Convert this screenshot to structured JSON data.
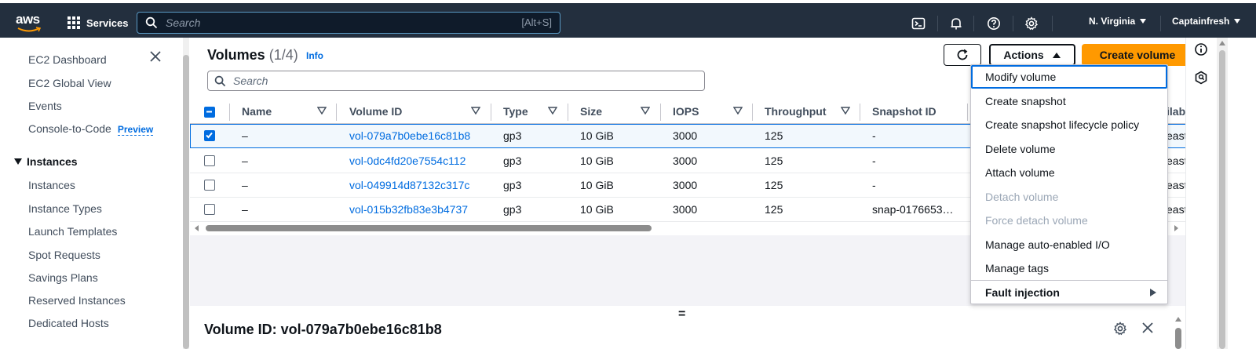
{
  "topbar": {
    "logo": "aws",
    "services_label": "Services",
    "search_placeholder": "Search",
    "search_shortcut": "[Alt+S]",
    "region": "N. Virginia",
    "account": "Captainfresh",
    "icons": [
      "cloudshell-icon",
      "notifications-icon",
      "help-icon",
      "settings-icon"
    ],
    "bg_color": "#232f3e"
  },
  "sidebar": {
    "items_top": [
      "EC2 Dashboard",
      "EC2 Global View",
      "Events",
      "Console-to-Code"
    ],
    "preview_tag": "Preview",
    "section": "Instances",
    "section_items": [
      "Instances",
      "Instance Types",
      "Launch Templates",
      "Spot Requests",
      "Savings Plans",
      "Reserved Instances",
      "Dedicated Hosts"
    ]
  },
  "main": {
    "title": "Volumes",
    "count": "(1/4)",
    "info": "Info",
    "actions_label": "Actions",
    "create_label": "Create volume",
    "search_placeholder": "Search",
    "columns": [
      "Name",
      "Volume ID",
      "Type",
      "Size",
      "IOPS",
      "Throughput",
      "Snapshot ID",
      "ilab"
    ],
    "rows": [
      {
        "selected": true,
        "name": "–",
        "volume_id": "vol-079a7b0ebe16c81b8",
        "type": "gp3",
        "size": "10 GiB",
        "iops": "3000",
        "throughput": "125",
        "snapshot": "-",
        "az": "east"
      },
      {
        "selected": false,
        "name": "–",
        "volume_id": "vol-0dc4fd20e7554c112",
        "type": "gp3",
        "size": "10 GiB",
        "iops": "3000",
        "throughput": "125",
        "snapshot": "-",
        "az": "east"
      },
      {
        "selected": false,
        "name": "–",
        "volume_id": "vol-049914d87132c317c",
        "type": "gp3",
        "size": "10 GiB",
        "iops": "3000",
        "throughput": "125",
        "snapshot": "-",
        "az": "east"
      },
      {
        "selected": false,
        "name": "–",
        "volume_id": "vol-015b32fb83e3b4737",
        "type": "gp3",
        "size": "10 GiB",
        "iops": "3000",
        "throughput": "125",
        "snapshot": "snap-0176653…",
        "az": "east"
      }
    ],
    "detail_title": "Volume ID: vol-079a7b0ebe16c81b8",
    "resizer": "="
  },
  "actions_menu": {
    "items": [
      {
        "label": "Modify volume",
        "state": "focused"
      },
      {
        "label": "Create snapshot",
        "state": "enabled"
      },
      {
        "label": "Create snapshot lifecycle policy",
        "state": "enabled"
      },
      {
        "label": "Delete volume",
        "state": "enabled"
      },
      {
        "label": "Attach volume",
        "state": "enabled"
      },
      {
        "label": "Detach volume",
        "state": "disabled"
      },
      {
        "label": "Force detach volume",
        "state": "disabled"
      },
      {
        "label": "Manage auto-enabled I/O",
        "state": "enabled"
      },
      {
        "label": "Manage tags",
        "state": "enabled"
      },
      {
        "label": "Fault injection",
        "state": "submenu"
      }
    ]
  },
  "colors": {
    "accent": "#006ce0",
    "primary_button": "#ff9900",
    "disabled_text": "#9ba7b6"
  }
}
